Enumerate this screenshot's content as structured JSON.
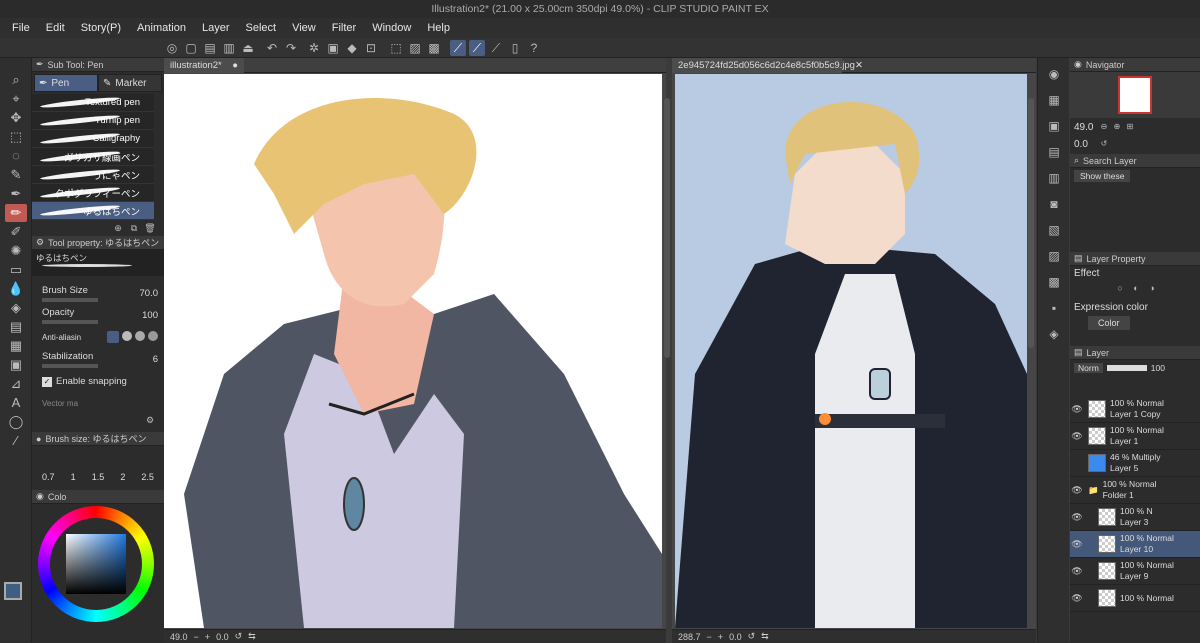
{
  "window": {
    "title": "Illustration2* (21.00 x 25.00cm 350dpi 49.0%) - CLIP STUDIO PAINT EX"
  },
  "menu": [
    "File",
    "Edit",
    "Story(P)",
    "Animation",
    "Layer",
    "Select",
    "View",
    "Filter",
    "Window",
    "Help"
  ],
  "subtool": {
    "header": "Sub Tool: Pen",
    "tabs": [
      "Pen",
      "Marker"
    ],
    "brushes": [
      "Textured pen",
      "Turnip pen",
      "Calligraphy",
      "ガサガサ線画ペン",
      "うにゃペン",
      "タポグラフィーペン",
      "ゆるはちペン"
    ],
    "selected_index": 6
  },
  "tool_property": {
    "header": "Tool property: ゆるはちペン",
    "brush_name": "ゆるはちペン",
    "brush_size_label": "Brush Size",
    "brush_size_value": "70.0",
    "opacity_label": "Opacity",
    "opacity_value": "100",
    "antialias_label": "Anti-aliasin",
    "stabilization_label": "Stabilization",
    "stabilization_value": "6",
    "snapping_label": "Enable snapping",
    "vector_label": "Vector ma"
  },
  "brush_size_panel": {
    "header": "Brush size: ゆるはちペン",
    "sizes": [
      "0.7",
      "1",
      "1.5",
      "2",
      "2.5"
    ]
  },
  "color_panel": {
    "header": "Colo",
    "main_color": "#3d5f82",
    "sub_color": "#111111"
  },
  "canvas1": {
    "tab": "illustration2*",
    "zoom": "49.0",
    "angle": "0.0"
  },
  "canvas2": {
    "tab": "2e945724fd25d056c6d2c4e8c5f0b5c9.jpg",
    "zoom": "288.7",
    "angle": "0.0"
  },
  "navigator": {
    "header": "Navigator",
    "zoom": "49.0",
    "angle": "0.0"
  },
  "search_layer": {
    "header": "Search Layer",
    "filter": "Show these"
  },
  "layer_property": {
    "header": "Layer Property",
    "effect_label": "Effect",
    "expression_label": "Expression color",
    "color_label": "Color"
  },
  "layer_panel": {
    "header": "Layer",
    "blend_mode": "Norm",
    "opacity": "100",
    "layers": [
      {
        "line1": "100 % Normal",
        "line2": "Layer 1 Copy",
        "indent": 0
      },
      {
        "line1": "100 % Normal",
        "line2": "Layer 1",
        "indent": 0
      },
      {
        "line1": "46 % Multiply",
        "line2": "Layer 5",
        "indent": 0
      },
      {
        "line1": "100 % Normal",
        "line2": "Folder 1",
        "indent": 0
      },
      {
        "line1": "100 % N",
        "line2": "Layer 3",
        "indent": 1
      },
      {
        "line1": "100 % Normal",
        "line2": "Layer 10",
        "indent": 1
      },
      {
        "line1": "100 % Normal",
        "line2": "Layer 9",
        "indent": 1
      },
      {
        "line1": "100 % Normal",
        "line2": "",
        "indent": 1
      }
    ],
    "selected_index": 5
  }
}
